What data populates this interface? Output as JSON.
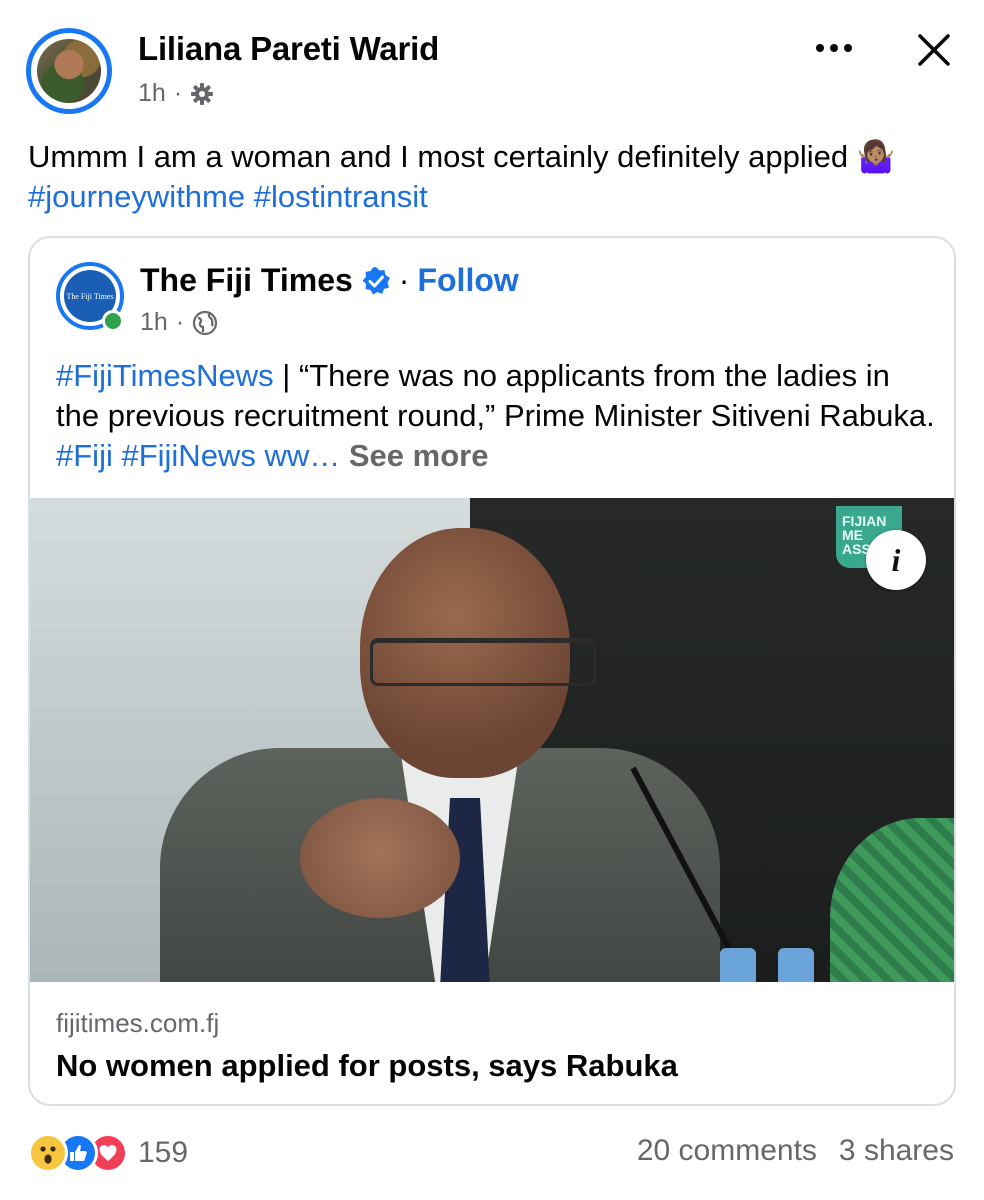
{
  "post": {
    "author": "Liliana Pareti Warid",
    "time": "1h",
    "separator": "·",
    "text_plain": "Ummm I am a woman and I most certainly definitely applied ",
    "emoji": "🤷🏽‍♀️",
    "hashtags": [
      "#journeywithme",
      "#lostintransit"
    ]
  },
  "card": {
    "page_name": "The Fiji Times",
    "follow_label": "Follow",
    "separator": "·",
    "time": "1h",
    "avatar_text": "The Fiji Times",
    "text_hashtag": "#FijiTimesNews",
    "text_body": " | “There was no applicants from the ladies in the previous recruitment round,” Prime Minister Sitiveni Rabuka. ",
    "text_tags": [
      "#Fiji",
      "#FijiNews"
    ],
    "text_trunc": "ww…",
    "see_more_label": "See more",
    "image_logo_text": "FIJIAN ME ASSO",
    "info_icon": "i",
    "link_domain": "fijitimes.com.fj",
    "link_title": "No women applied for posts, says Rabuka"
  },
  "footer": {
    "reaction_count": "159",
    "comments": "20 comments",
    "shares": "3 shares"
  },
  "icons": {
    "more": "more-horizontal-icon",
    "close": "close-icon",
    "privacy_friends": "gear-icon",
    "privacy_public": "globe-icon",
    "verified": "verified-badge-icon"
  },
  "colors": {
    "link": "#1e6fd9",
    "brand": "#1877f2",
    "muted": "#65676b",
    "online": "#31a24c"
  }
}
